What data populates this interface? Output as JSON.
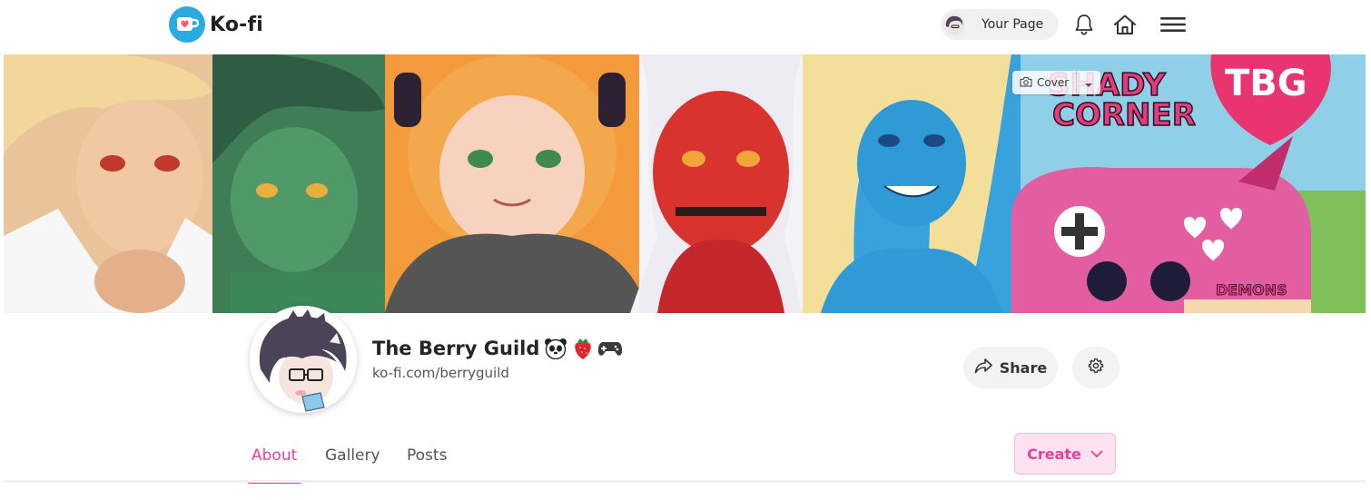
{
  "nav": {
    "brand": "Ko-fi",
    "your_page_label": "Your Page",
    "icons": [
      "kofi-cup-icon",
      "bell-icon",
      "home-icon",
      "menu-icon"
    ]
  },
  "cover": {
    "button_label": "Cover",
    "icons": [
      "camera-icon",
      "caret-down-icon"
    ],
    "art_text_1": "SHADY",
    "art_text_2": "CORNER",
    "art_text_3": "TBG",
    "art_text_4": "DEMONS"
  },
  "profile": {
    "name": "The Berry Guild",
    "emojis": [
      "panda-emoji",
      "strawberry-emoji",
      "gamepad-emoji"
    ],
    "url": "ko-fi.com/berryguild",
    "share_label": "Share",
    "icons": [
      "share-icon",
      "gear-icon"
    ]
  },
  "tabs": {
    "items": [
      {
        "label": "About",
        "active": true
      },
      {
        "label": "Gallery",
        "active": false
      },
      {
        "label": "Posts",
        "active": false
      }
    ],
    "create_label": "Create"
  },
  "colors": {
    "accent": "#e8409a",
    "brand_blue": "#29abe0",
    "create_bg": "#fde3f1"
  }
}
